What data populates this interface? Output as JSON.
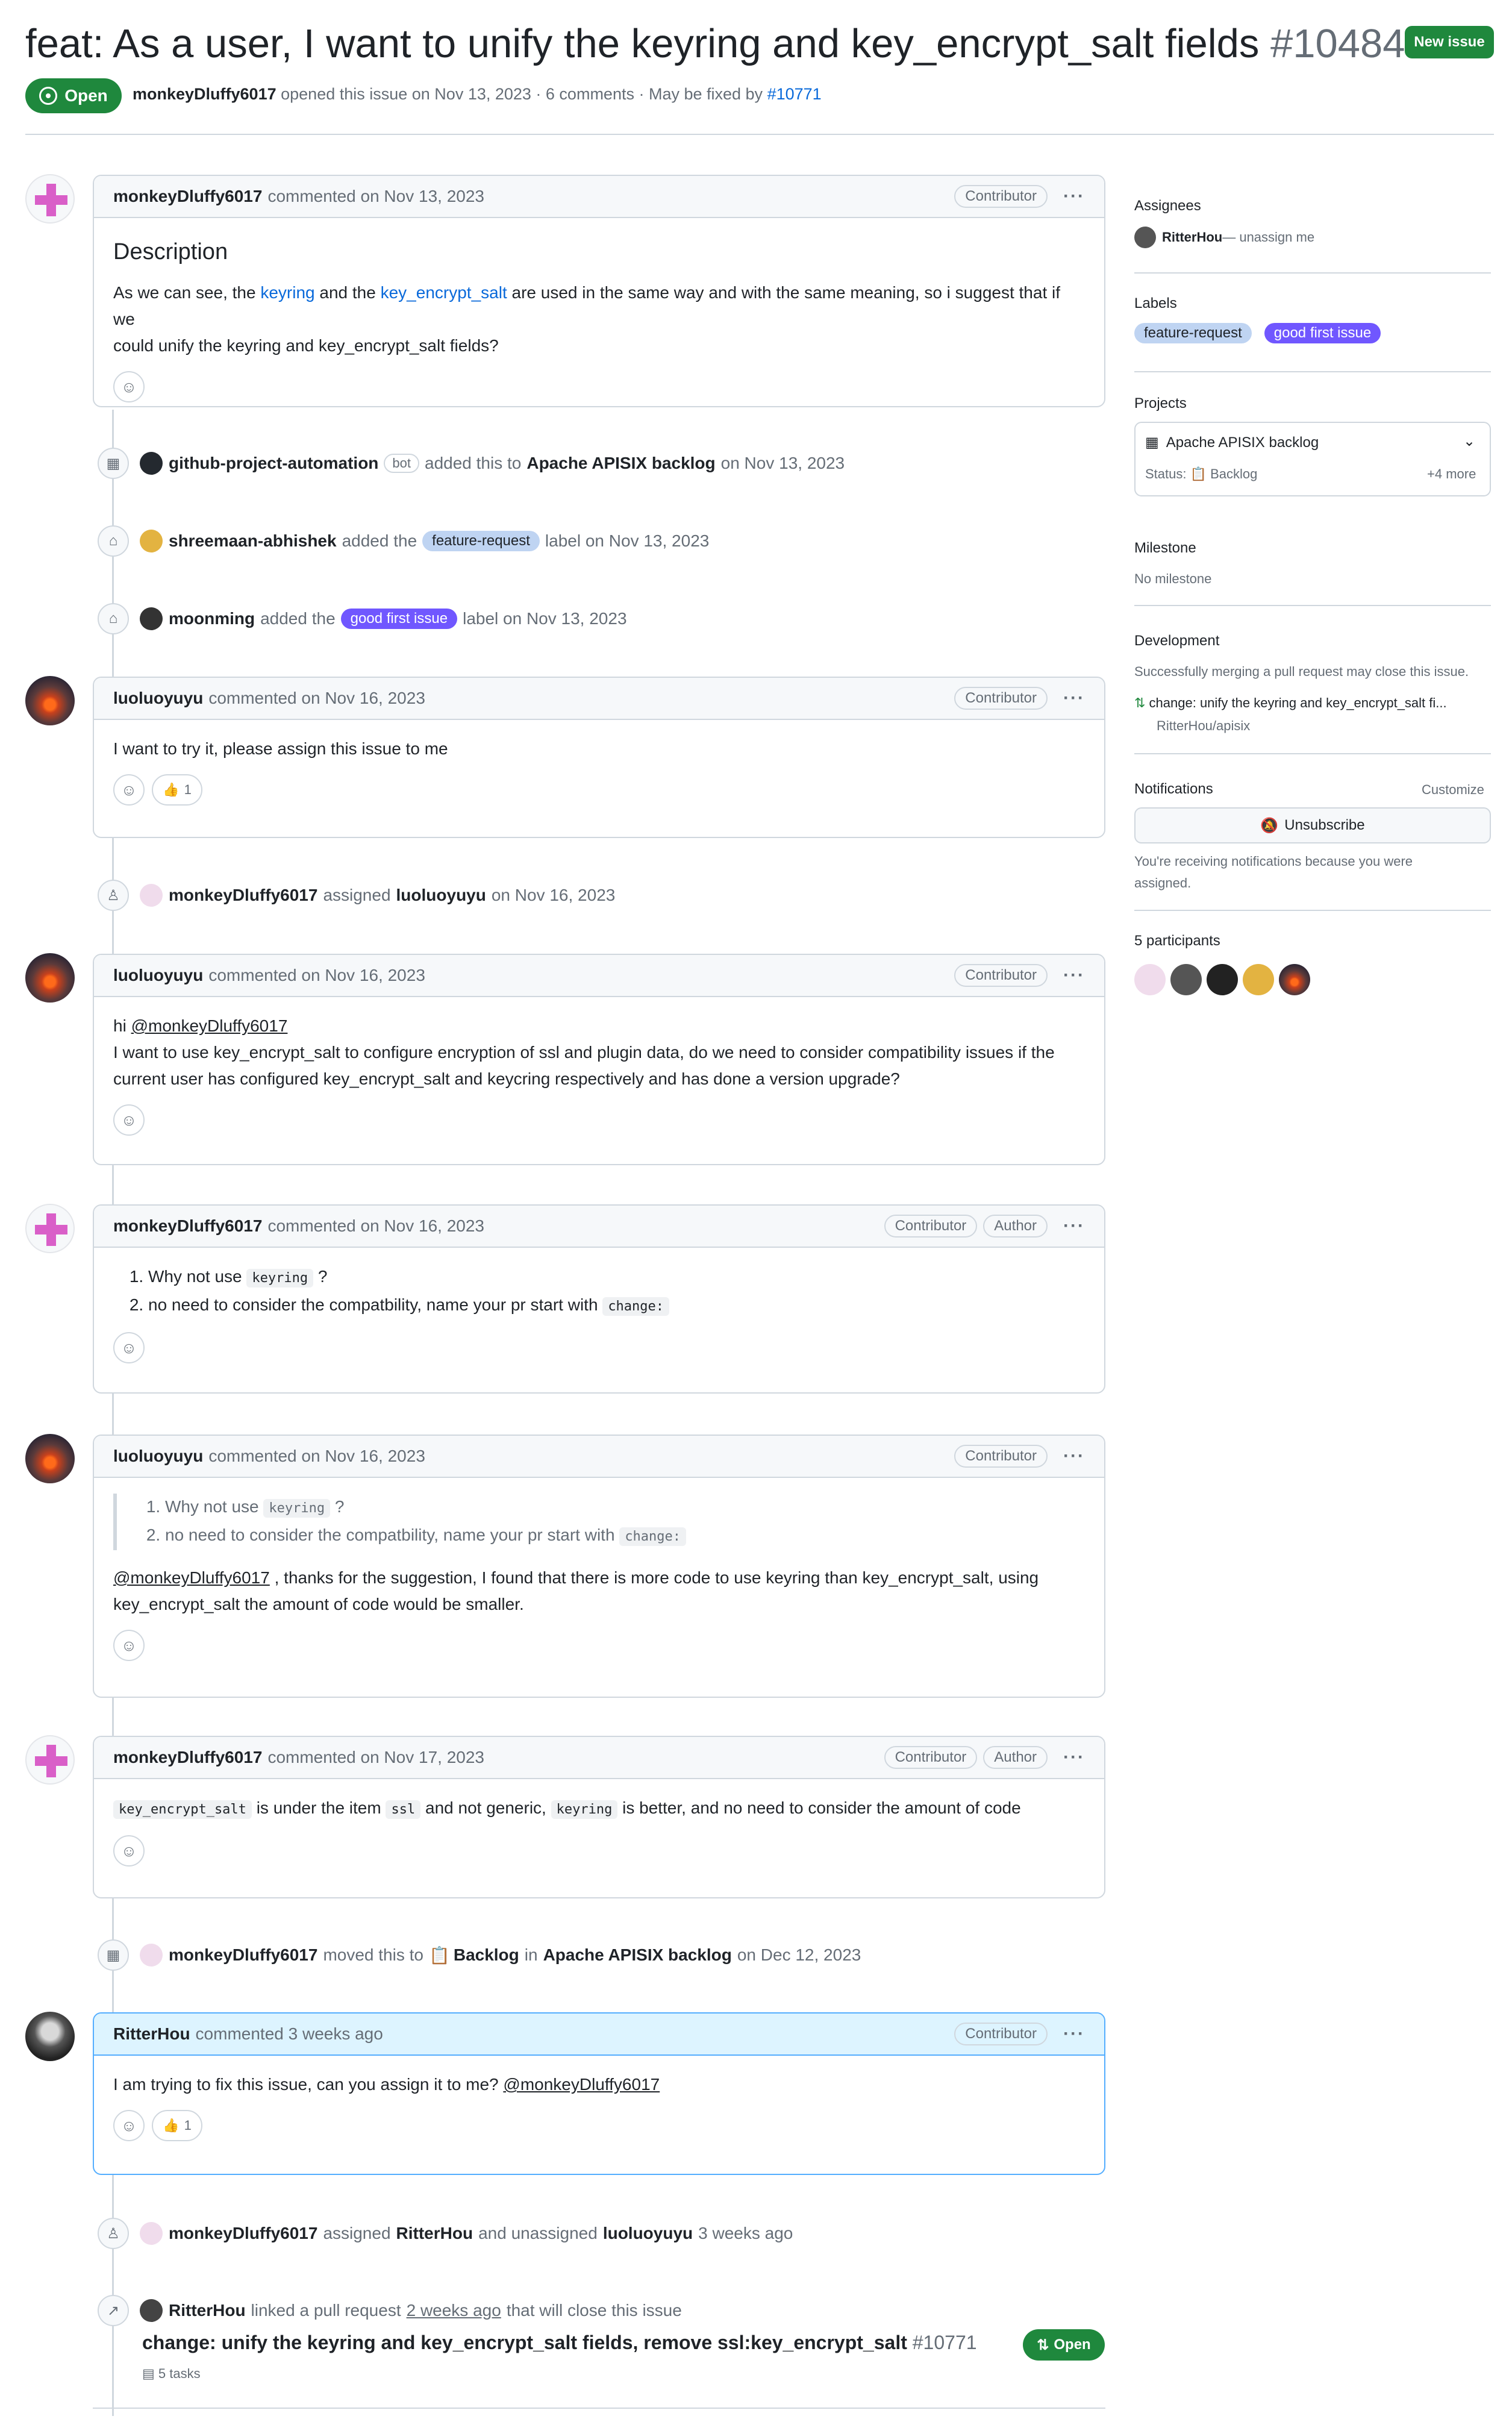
{
  "header": {
    "title": "feat: As a user, I want to unify the keyring and key_encrypt_salt fields",
    "number": "#10484",
    "new_issue_label": "New issue",
    "state": "Open",
    "author": "monkeyDluffy6017",
    "opened_text": "opened this issue on Nov 13, 2023 · 6 comments · May be fixed by",
    "fixed_by": "#10771"
  },
  "badges": {
    "contributor": "Contributor",
    "author": "Author",
    "bot": "bot"
  },
  "labels": {
    "feature_request": "feature-request",
    "good_first_issue": "good first issue"
  },
  "comment1": {
    "user": "monkeyDluffy6017",
    "meta": "commented on Nov 13, 2023",
    "heading": "Description",
    "p1a": "As we can see, the ",
    "link1": "keyring",
    "p1b": " and the ",
    "link2": "key_encrypt_salt",
    "p1c": " are used in the same way and with the same meaning, so i suggest that if we",
    "p1d": "could unify the keyring and key_encrypt_salt fields?"
  },
  "event1": {
    "user": "github-project-automation",
    "text": "added this to",
    "project": "Apache APISIX backlog",
    "date": "on Nov 13, 2023"
  },
  "event2": {
    "user": "shreemaan-abhishek",
    "text": "added the",
    "text2": "label on Nov 13, 2023"
  },
  "event3": {
    "user": "moonming",
    "text": "added the",
    "text2": "label on Nov 13, 2023"
  },
  "comment2": {
    "user": "luoluoyuyu",
    "meta": "commented on Nov 16, 2023",
    "body": "I want to try it, please assign this issue to me",
    "thumbs": "1"
  },
  "event4": {
    "user": "monkeyDluffy6017",
    "text": "assigned",
    "target": "luoluoyuyu",
    "date": "on Nov 16, 2023"
  },
  "comment3": {
    "user": "luoluoyuyu",
    "meta": "commented on Nov 16, 2023",
    "hi": "hi ",
    "mention": "@monkeyDluffy6017",
    "l2": "I want to use key_encrypt_salt to configure encryption of ssl and plugin data, do we need to consider compatibility issues if the",
    "l3": "current user has configured key_encrypt_salt and keycring respectively and has done a version upgrade?"
  },
  "comment4": {
    "user": "monkeyDluffy6017",
    "meta": "commented on Nov 16, 2023",
    "li1": "Why not use ",
    "code1": "keyring",
    "li1b": " ?",
    "li2": "no need to consider the compatbility, name your pr start with ",
    "code2": "change:"
  },
  "comment5": {
    "user": "luoluoyuyu",
    "meta": "commented on Nov 16, 2023",
    "q1": "Why not use ",
    "qcode1": "keyring",
    "q1b": " ?",
    "q2": "no need to consider the compatbility, name your pr start with ",
    "qcode2": "change:",
    "mention": "@monkeyDluffy6017",
    "p1": " ,   thanks for the suggestion, I found that there is more code to use keyring than key_encrypt_salt, using",
    "p2": "key_encrypt_salt the amount of code would be smaller."
  },
  "comment6": {
    "user": "monkeyDluffy6017",
    "meta": "commented on Nov 17, 2023",
    "c1": "key_encrypt_salt",
    "t1": " is under the item ",
    "c2": "ssl",
    "t2": " and not generic, ",
    "c3": "keyring",
    "t3": " is better, and no need to consider the amount of code"
  },
  "event5": {
    "user": "monkeyDluffy6017",
    "text": "moved this to",
    "column": "Backlog",
    "in": "in",
    "project": "Apache APISIX backlog",
    "date": "on Dec 12, 2023"
  },
  "comment7": {
    "user": "RitterHou",
    "meta": "commented 3 weeks ago",
    "body": "I am trying to fix this issue, can you assign it to me? ",
    "mention": "@monkeyDluffy6017",
    "thumbs": "1"
  },
  "event6": {
    "user": "monkeyDluffy6017",
    "text": "assigned",
    "target": "RitterHou",
    "text2": "and unassigned",
    "target2": "luoluoyuyu",
    "date": "3 weeks ago"
  },
  "event7": {
    "user": "RitterHou",
    "text": "linked a pull request",
    "when": "2 weeks ago",
    "text2": "that will close this issue",
    "pr_title": "change: unify the keyring and key_encrypt_salt fields, remove ssl:key_encrypt_salt",
    "pr_num": "#10771",
    "pr_state": "Open",
    "tasks": "5 tasks"
  },
  "sidebar": {
    "assignees_h": "Assignees",
    "assignee": "RitterHou",
    "unassign": "— unassign me",
    "labels_h": "Labels",
    "projects_h": "Projects",
    "project": "Apache APISIX backlog",
    "status_label": "Status:",
    "status_value": "Backlog",
    "more": "+4 more",
    "milestone_h": "Milestone",
    "milestone": "No milestone",
    "development_h": "Development",
    "dev_text": "Successfully merging a pull request may close this issue.",
    "dev_pr": "change: unify the keyring and key_encrypt_salt fi...",
    "dev_repo": "RitterHou/apisix",
    "notifications_h": "Notifications",
    "customize": "Customize",
    "unsubscribe": "Unsubscribe",
    "notif_text1": "You're receiving notifications because you were",
    "notif_text2": "assigned.",
    "participants": "5 participants"
  }
}
